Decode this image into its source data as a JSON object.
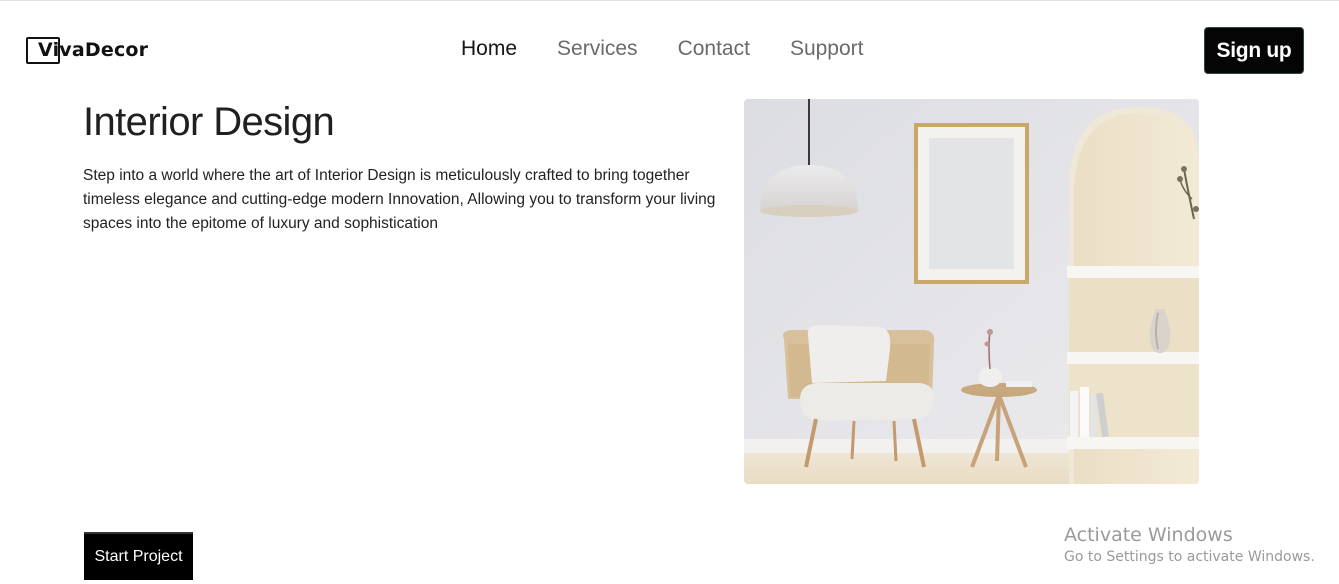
{
  "header": {
    "logo_text": "VivaDecor",
    "nav": [
      {
        "label": "Home",
        "active": true
      },
      {
        "label": "Services",
        "active": false
      },
      {
        "label": "Contact",
        "active": false
      },
      {
        "label": "Support",
        "active": false
      }
    ],
    "signup_label": "Sign up"
  },
  "hero": {
    "title": "Interior Design",
    "description": "Step into a world where the art of Interior Design is meticulously crafted to bring together timeless elegance and cutting-edge modern Innovation, Allowing you to transform your living spaces into the epitome of luxury and sophistication",
    "cta_label": "Start Project",
    "image_alt": "interior-room-photo"
  },
  "watermark": {
    "title": "Activate Windows",
    "subtitle": "Go to Settings to activate Windows."
  },
  "colors": {
    "accent": "#000000",
    "nav_inactive": "#6a6a6a",
    "watermark": "#9a9a9a"
  }
}
